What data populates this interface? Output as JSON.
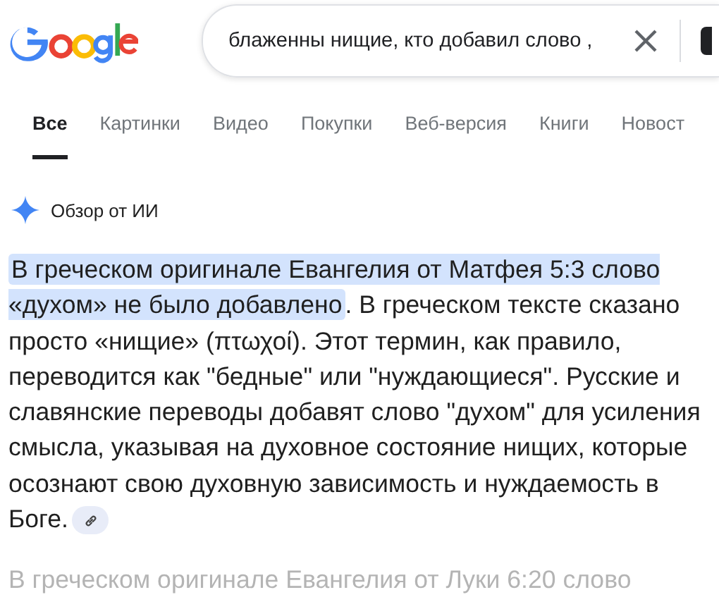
{
  "header": {
    "search": {
      "value": "блаженны нищие, кто добавил слово ,"
    }
  },
  "tabs": [
    {
      "label": "Все",
      "selected": true
    },
    {
      "label": "Картинки",
      "selected": false
    },
    {
      "label": "Видео",
      "selected": false
    },
    {
      "label": "Покупки",
      "selected": false
    },
    {
      "label": "Веб-версия",
      "selected": false
    },
    {
      "label": "Книги",
      "selected": false
    },
    {
      "label": "Новост",
      "selected": false
    }
  ],
  "overview": {
    "title": "Обзор от ИИ",
    "highlight": "В греческом оригинале Евангелия от Матфея 5:3 слово «духом» не было добавлено",
    "text": ". В греческом тексте сказано просто «нищие» (πτωχοί). Этот термин, как правило, переводится как \"бедные\" или \"нуждающиеся\". Русские и славянские переводы добавят слово \"духом\" для усиления смысла, указывая на духовное состояние нищих, которые осознают свою духовную зависимость и нуждаемость в Боге.",
    "faded": "В греческом оригинале Евангелия от Луки 6:20 слово"
  }
}
